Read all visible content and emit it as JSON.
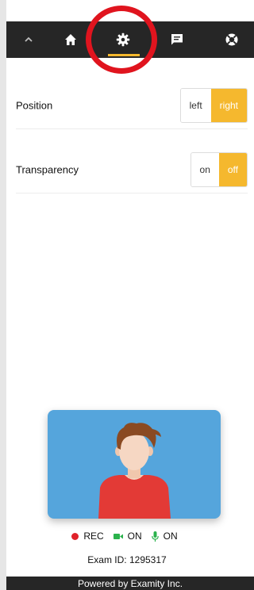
{
  "nav": {
    "items": [
      {
        "icon": "chevron-up-icon"
      },
      {
        "icon": "home-icon"
      },
      {
        "icon": "gear-icon",
        "active": true
      },
      {
        "icon": "chat-icon"
      },
      {
        "icon": "lifebuoy-icon"
      }
    ],
    "active_color": "#f5b82e"
  },
  "settings": [
    {
      "label": "Position",
      "options": [
        "left",
        "right"
      ],
      "selected": "right"
    },
    {
      "label": "Transparency",
      "options": [
        "on",
        "off"
      ],
      "selected": "off"
    }
  ],
  "status": {
    "rec_label": "REC",
    "camera_label": "ON",
    "mic_label": "ON"
  },
  "exam_id_text": "Exam ID: 1295317",
  "footer_text": "Powered by Examity Inc.",
  "colors": {
    "navbar": "#262626",
    "accent": "#f5b82e",
    "rec": "#e0222a",
    "on": "#2bb24c",
    "card": "#55a5dc"
  }
}
